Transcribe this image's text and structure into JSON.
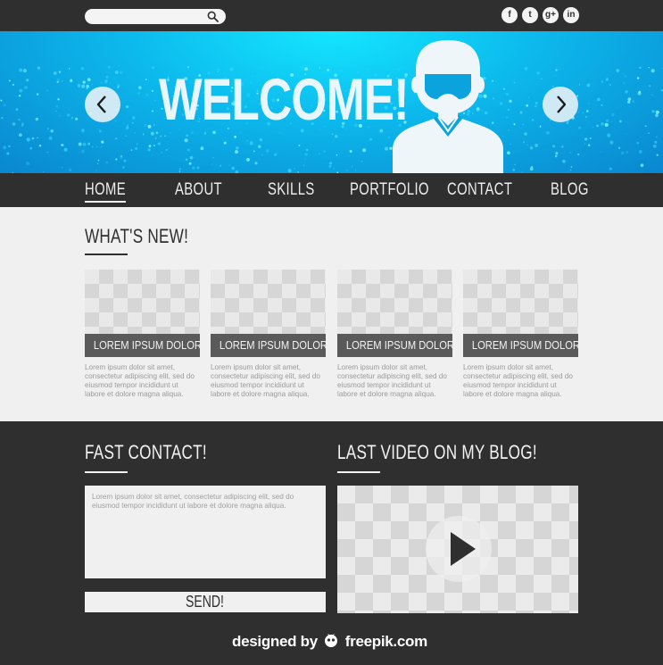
{
  "topbar": {
    "search": {
      "placeholder": "",
      "icon": "search-icon"
    },
    "social": [
      {
        "icon": "facebook-icon",
        "glyph": "f"
      },
      {
        "icon": "twitter-icon",
        "glyph": "t"
      },
      {
        "icon": "googleplus-icon",
        "glyph": "g+"
      },
      {
        "icon": "linkedin-icon",
        "glyph": "in"
      }
    ]
  },
  "hero": {
    "title": "WELCOME!",
    "prev_icon": "chevron-left-icon",
    "next_icon": "chevron-right-icon",
    "avatar_icon": "user-avatar-icon",
    "colors": {
      "light": "#14e6ff",
      "mid": "#0cb8ec",
      "dark": "#0a86cf"
    }
  },
  "nav": {
    "items": [
      "HOME",
      "ABOUT",
      "SKILLS",
      "PORTFOLIO",
      "CONTACT",
      "BLOG"
    ],
    "active": "HOME"
  },
  "whats_new": {
    "title": "WHAT'S NEW!",
    "cards": [
      {
        "label": "LOREM IPSUM DOLOR",
        "text": "Lorem ipsum dolor sit amet, consectetur adipiscing elit, sed do eiusmod tempor incididunt ut labore et dolore magna aliqua."
      },
      {
        "label": "LOREM IPSUM DOLOR",
        "text": "Lorem ipsum dolor sit amet, consectetur adipiscing elit, sed do eiusmod tempor incididunt ut labore et dolore magna aliqua."
      },
      {
        "label": "LOREM IPSUM DOLOR",
        "text": "Lorem ipsum dolor sit amet, consectetur adipiscing elit, sed do eiusmod tempor incididunt ut labore et dolore magna aliqua."
      },
      {
        "label": "LOREM IPSUM DOLOR",
        "text": "Lorem ipsum dolor sit amet, consectetur adipiscing elit, sed do eiusmod tempor incididunt ut labore et dolore magna aliqua."
      }
    ]
  },
  "contact": {
    "title": "FAST CONTACT!",
    "message": "Lorem ipsum dolor sit amet, consectetur adipiscing elit, sed do eiusmod tempor incididunt ut labore et dolore magna aliqua.",
    "send_label": "SEND!"
  },
  "video": {
    "title": "LAST VIDEO ON MY BLOG!",
    "play_icon": "play-icon"
  },
  "footer": {
    "designed_by": "designed by",
    "brand": "freepik.com",
    "logo_icon": "freepik-logo-icon"
  },
  "colors": {
    "dark": "#2f2f2f",
    "light": "#f0f0f0"
  }
}
